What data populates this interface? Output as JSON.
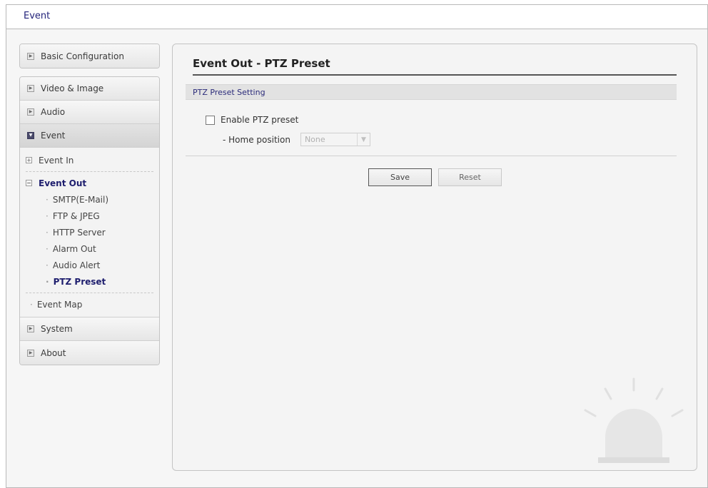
{
  "header": {
    "title": "Event"
  },
  "sidebar": {
    "basic": "Basic Configuration",
    "items": [
      {
        "label": "Video & Image"
      },
      {
        "label": "Audio"
      },
      {
        "label": "Event"
      }
    ],
    "event_sub": {
      "event_in": "Event In",
      "event_out": "Event Out",
      "leaves": [
        "SMTP(E-Mail)",
        "FTP & JPEG",
        "HTTP Server",
        "Alarm Out",
        "Audio Alert",
        "PTZ Preset"
      ],
      "event_map": "Event Map"
    },
    "bottom": [
      {
        "label": "System"
      },
      {
        "label": "About"
      }
    ]
  },
  "main": {
    "title": "Event Out - PTZ Preset",
    "section": "PTZ Preset Setting",
    "enable_label": "Enable PTZ preset",
    "enable_checked": false,
    "home_label": "- Home position",
    "home_value": "None",
    "save_label": "Save",
    "reset_label": "Reset"
  }
}
